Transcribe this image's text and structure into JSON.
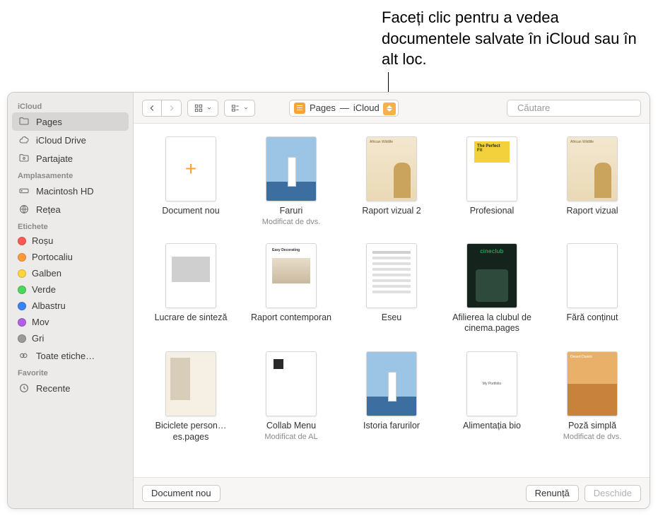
{
  "callout": "Faceți clic pentru a vedea documentele salvate în iCloud sau în alt loc.",
  "sidebar": {
    "sections": [
      {
        "title": "iCloud",
        "items": [
          {
            "label": "Pages",
            "icon": "folder",
            "selected": true
          },
          {
            "label": "iCloud Drive",
            "icon": "cloud"
          },
          {
            "label": "Partajate",
            "icon": "shared-folder"
          }
        ]
      },
      {
        "title": "Amplasamente",
        "items": [
          {
            "label": "Macintosh HD",
            "icon": "disk"
          },
          {
            "label": "Rețea",
            "icon": "globe"
          }
        ]
      },
      {
        "title": "Etichete",
        "items": [
          {
            "label": "Roșu",
            "icon": "tag",
            "color": "#ff5b52"
          },
          {
            "label": "Portocaliu",
            "icon": "tag",
            "color": "#ff9a3c"
          },
          {
            "label": "Galben",
            "icon": "tag",
            "color": "#ffd53c"
          },
          {
            "label": "Verde",
            "icon": "tag",
            "color": "#4cd75a"
          },
          {
            "label": "Albastru",
            "icon": "tag",
            "color": "#3a82f7"
          },
          {
            "label": "Mov",
            "icon": "tag",
            "color": "#b060e8"
          },
          {
            "label": "Gri",
            "icon": "tag",
            "color": "#9a9a98"
          },
          {
            "label": "Toate etiche…",
            "icon": "all-tags"
          }
        ]
      },
      {
        "title": "Favorite",
        "items": [
          {
            "label": "Recente",
            "icon": "clock"
          }
        ]
      }
    ]
  },
  "toolbar": {
    "location_app": "Pages",
    "location_place": "iCloud",
    "search_placeholder": "Căutare"
  },
  "documents": [
    {
      "title": "Document nou",
      "subtitle": "",
      "thumb": "new"
    },
    {
      "title": "Faruri",
      "subtitle": "Modificat de dvs.",
      "thumb": "t-lighthouse"
    },
    {
      "title": "Raport vizual 2",
      "subtitle": "",
      "thumb": "t-giraffe"
    },
    {
      "title": "Profesional",
      "subtitle": "",
      "thumb": "t-perfect"
    },
    {
      "title": "Raport vizual",
      "subtitle": "",
      "thumb": "t-giraffe"
    },
    {
      "title": "Lucrare de sinteză",
      "subtitle": "",
      "thumb": "t-photo"
    },
    {
      "title": "Raport contemporan",
      "subtitle": "",
      "thumb": "t-interior"
    },
    {
      "title": "Eseu",
      "subtitle": "",
      "thumb": "t-text"
    },
    {
      "title": "Afilierea la clubul de cinema.pages",
      "subtitle": "",
      "thumb": "t-cine"
    },
    {
      "title": "Fără conținut",
      "subtitle": "",
      "thumb": "t-blank"
    },
    {
      "title": "Biciclete person…es.pages",
      "subtitle": "",
      "thumb": "t-bike"
    },
    {
      "title": "Collab Menu",
      "subtitle": "Modificat de AL",
      "thumb": "t-collab"
    },
    {
      "title": "Istoria farurilor",
      "subtitle": "",
      "thumb": "t-lighthouse"
    },
    {
      "title": "Alimentația bio",
      "subtitle": "",
      "thumb": "t-portfolio"
    },
    {
      "title": "Poză simplă",
      "subtitle": "Modificat de dvs.",
      "thumb": "t-dunes"
    }
  ],
  "footer": {
    "new_document": "Document nou",
    "cancel": "Renunță",
    "open": "Deschide"
  }
}
